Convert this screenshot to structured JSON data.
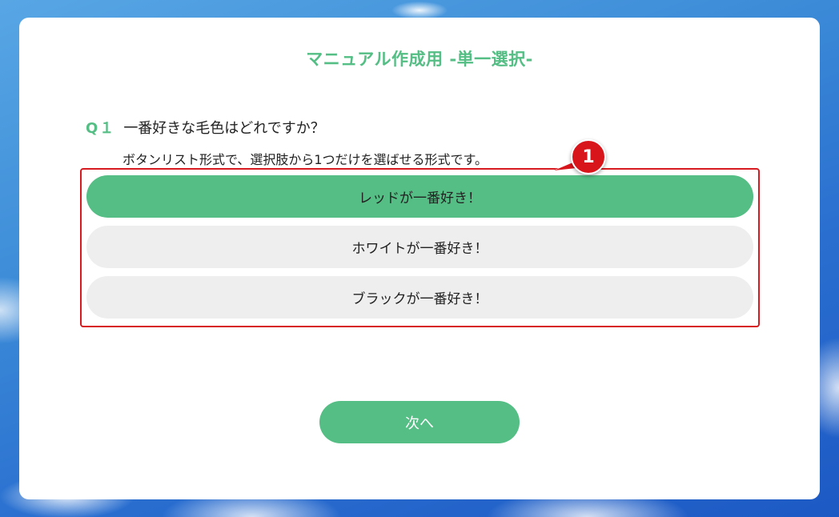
{
  "page": {
    "title": "マニュアル作成用 -単一選択-"
  },
  "question": {
    "number": "Q１",
    "text": "一番好きな毛色はどれですか？",
    "description": "ボタンリスト形式で、選択肢から1つだけを選ばせる形式です。"
  },
  "options": [
    {
      "label": "レッドが一番好き！",
      "selected": true
    },
    {
      "label": "ホワイトが一番好き！",
      "selected": false
    },
    {
      "label": "ブラックが一番好き！",
      "selected": false
    }
  ],
  "callout": {
    "number": "1"
  },
  "navigation": {
    "next_label": "次へ"
  },
  "colors": {
    "accent": "#54be84",
    "option_bg": "#eeeeee",
    "highlight": "#d71920"
  }
}
